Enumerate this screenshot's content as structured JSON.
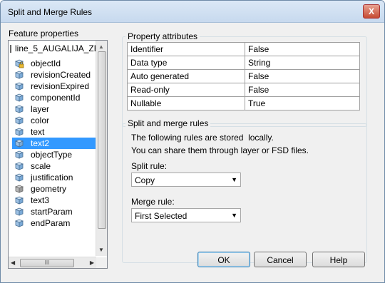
{
  "window": {
    "title": "Split and Merge Rules",
    "close_glyph": "X"
  },
  "feature_properties": {
    "label": "Feature properties",
    "layer": "line_5_AUGALIJA_ZE",
    "items": [
      {
        "label": "objectId",
        "icon": "locked-attribute-icon",
        "selected": false
      },
      {
        "label": "revisionCreated",
        "icon": "attribute-icon",
        "selected": false
      },
      {
        "label": "revisionExpired",
        "icon": "attribute-icon",
        "selected": false
      },
      {
        "label": "componentId",
        "icon": "attribute-icon",
        "selected": false
      },
      {
        "label": "layer",
        "icon": "attribute-icon",
        "selected": false
      },
      {
        "label": "color",
        "icon": "attribute-icon",
        "selected": false
      },
      {
        "label": "text",
        "icon": "attribute-icon",
        "selected": false
      },
      {
        "label": "text2",
        "icon": "attribute-icon",
        "selected": true
      },
      {
        "label": "objectType",
        "icon": "attribute-icon",
        "selected": false
      },
      {
        "label": "scale",
        "icon": "attribute-icon",
        "selected": false
      },
      {
        "label": "justification",
        "icon": "attribute-icon",
        "selected": false
      },
      {
        "label": "geometry",
        "icon": "geometry-attribute-icon",
        "selected": false
      },
      {
        "label": "text3",
        "icon": "attribute-icon",
        "selected": false
      },
      {
        "label": "startParam",
        "icon": "attribute-icon",
        "selected": false
      },
      {
        "label": "endParam",
        "icon": "attribute-icon",
        "selected": false
      }
    ],
    "hscroll_thumb_glyph": "III"
  },
  "property_attributes": {
    "title": "Property attributes",
    "rows": [
      {
        "name": "Identifier",
        "value": "False"
      },
      {
        "name": "Data type",
        "value": "String"
      },
      {
        "name": "Auto generated",
        "value": "False"
      },
      {
        "name": "Read-only",
        "value": "False"
      },
      {
        "name": "Nullable",
        "value": "True"
      }
    ]
  },
  "split_merge": {
    "title": "Split and merge rules",
    "info_line1": "The following rules are stored  locally.",
    "info_line2": "You can share them through layer or FSD files.",
    "split_label": "Split rule:",
    "split_value": "Copy",
    "merge_label": "Merge rule:",
    "merge_value": "First Selected"
  },
  "buttons": {
    "ok": "OK",
    "cancel": "Cancel",
    "help": "Help"
  },
  "colors": {
    "selection": "#3399ff",
    "titlebar": "#c7d9ee",
    "close": "#c54a32"
  }
}
